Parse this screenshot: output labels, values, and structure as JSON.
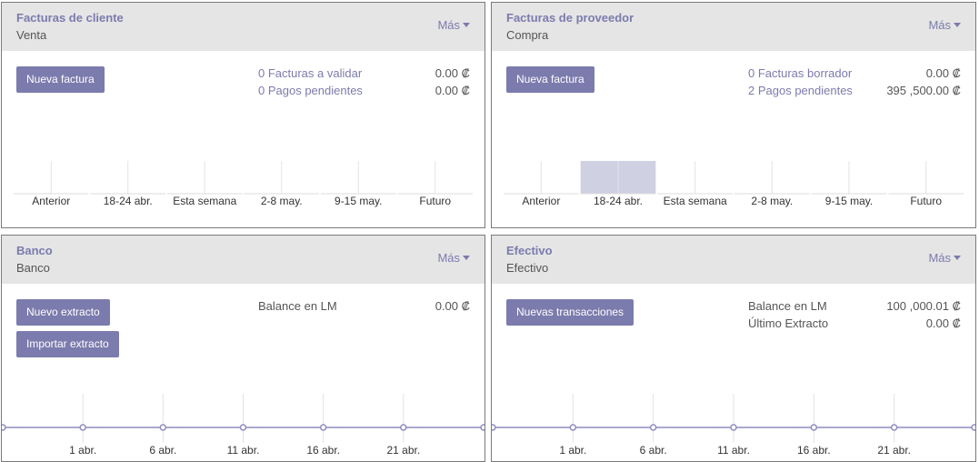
{
  "more_label": "Más",
  "colors": {
    "accent": "#7c7bad",
    "bar": "#cfd0e2",
    "header": "#e5e5e5",
    "line": "#8f8cc0"
  },
  "customer_invoices": {
    "title": "Facturas de cliente",
    "subtitle": "Venta",
    "button": "Nueva factura",
    "stats": [
      {
        "label": "0 Facturas a validar",
        "value": "0.00 ₡"
      },
      {
        "label": "0 Pagos pendientes",
        "value": "0.00 ₡"
      }
    ]
  },
  "vendor_bills": {
    "title": "Facturas de proveedor",
    "subtitle": "Compra",
    "button": "Nueva factura",
    "stats": [
      {
        "label": "0 Facturas borrador",
        "value": "0.00 ₡"
      },
      {
        "label": "2 Pagos pendientes",
        "value": "395 ,500.00 ₡"
      }
    ]
  },
  "bank": {
    "title": "Banco",
    "subtitle": "Banco",
    "buttons": [
      "Nuevo extracto",
      "Importar extracto"
    ],
    "stats": [
      {
        "label": "Balance en LM",
        "value": "0.00 ₡"
      }
    ]
  },
  "cash": {
    "title": "Efectivo",
    "subtitle": "Efectivo",
    "button": "Nuevas transacciones",
    "stats": [
      {
        "label": "Balance en LM",
        "value": "100 ,000.01 ₡"
      },
      {
        "label": "Último Extracto",
        "value": "0.00 ₡"
      }
    ]
  },
  "chart_data": [
    {
      "type": "bar",
      "categories": [
        "Anterior",
        "18-24 abr.",
        "Esta semana",
        "2-8 may.",
        "9-15 may.",
        "Futuro"
      ],
      "values": [
        0,
        0,
        0,
        0,
        0,
        0
      ]
    },
    {
      "type": "bar",
      "categories": [
        "Anterior",
        "18-24 abr.",
        "Esta semana",
        "2-8 may.",
        "9-15 may.",
        "Futuro"
      ],
      "values": [
        0,
        1,
        0,
        0,
        0,
        0
      ]
    },
    {
      "type": "line",
      "x_ticks": [
        "1 abr.",
        "6 abr.",
        "11 abr.",
        "16 abr.",
        "21 abr."
      ],
      "values": [
        0,
        0,
        0,
        0,
        0,
        0,
        0
      ]
    },
    {
      "type": "line",
      "x_ticks": [
        "1 abr.",
        "6 abr.",
        "11 abr.",
        "16 abr.",
        "21 abr."
      ],
      "values": [
        0,
        0,
        0,
        0,
        0,
        0,
        0
      ]
    }
  ]
}
